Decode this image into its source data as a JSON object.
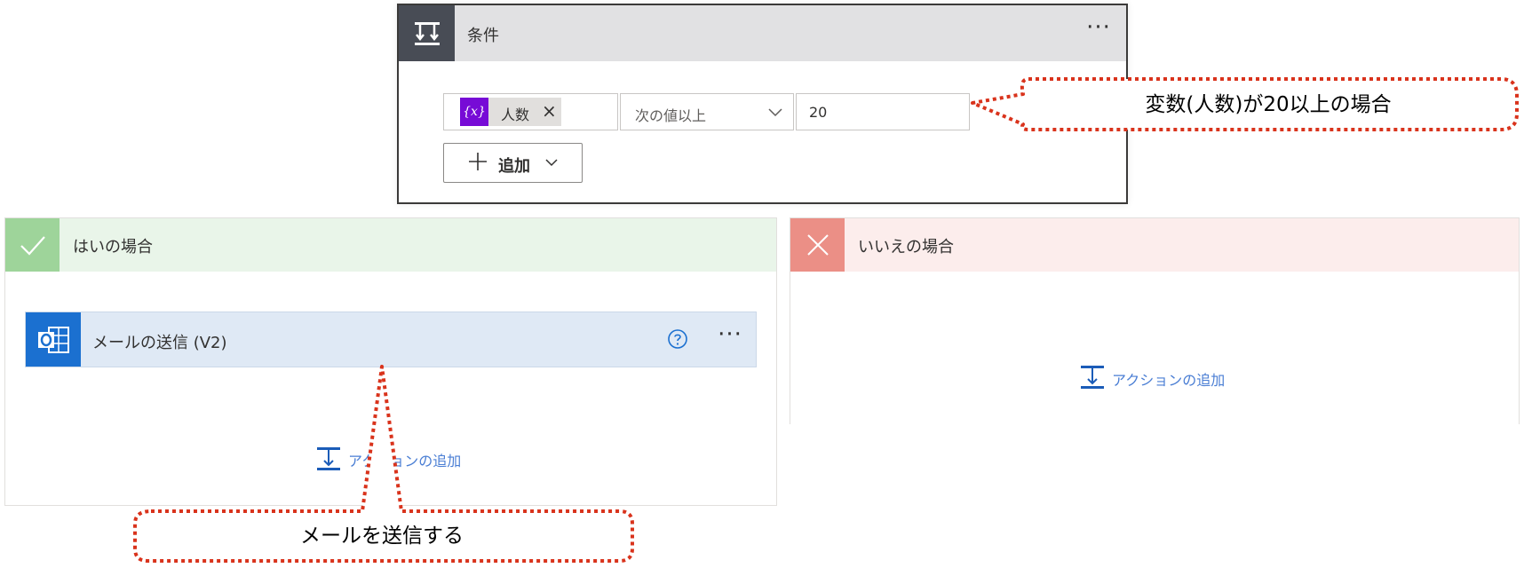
{
  "condition": {
    "title": "条件",
    "more": "···",
    "operand_icon": "{x}",
    "operand_label": "人数",
    "operand_remove": "×",
    "operator": "次の値以上",
    "value": "20",
    "add_label": "追加"
  },
  "yes_branch": {
    "title": "はいの場合",
    "action": {
      "title": "メールの送信 (V2)",
      "more": "···"
    },
    "add_action": "アクションの追加"
  },
  "no_branch": {
    "title": "いいえの場合",
    "add_action": "アクションの追加"
  },
  "callouts": {
    "condition_note": "変数(人数)が20以上の場合",
    "action_note": "メールを送信する"
  },
  "icons": {
    "condition": "condition-icon",
    "variable": "variable-icon",
    "check": "check-icon",
    "close": "close-icon",
    "outlook": "outlook-icon",
    "help": "help-icon",
    "add_action": "add-action-icon"
  },
  "colors": {
    "condition_header": "#e1e1e3",
    "condition_icon_bg": "#484c55",
    "variable_token": "#770bd6",
    "yes_header": "#e9f5e9",
    "yes_icon_bg": "#9ed49a",
    "no_header": "#fcedec",
    "no_icon_bg": "#eb8f86",
    "action_card": "#dfe9f5",
    "outlook_blue": "#1b70d0",
    "link_blue": "#4a7ed4",
    "callout_red": "#d9331c"
  }
}
